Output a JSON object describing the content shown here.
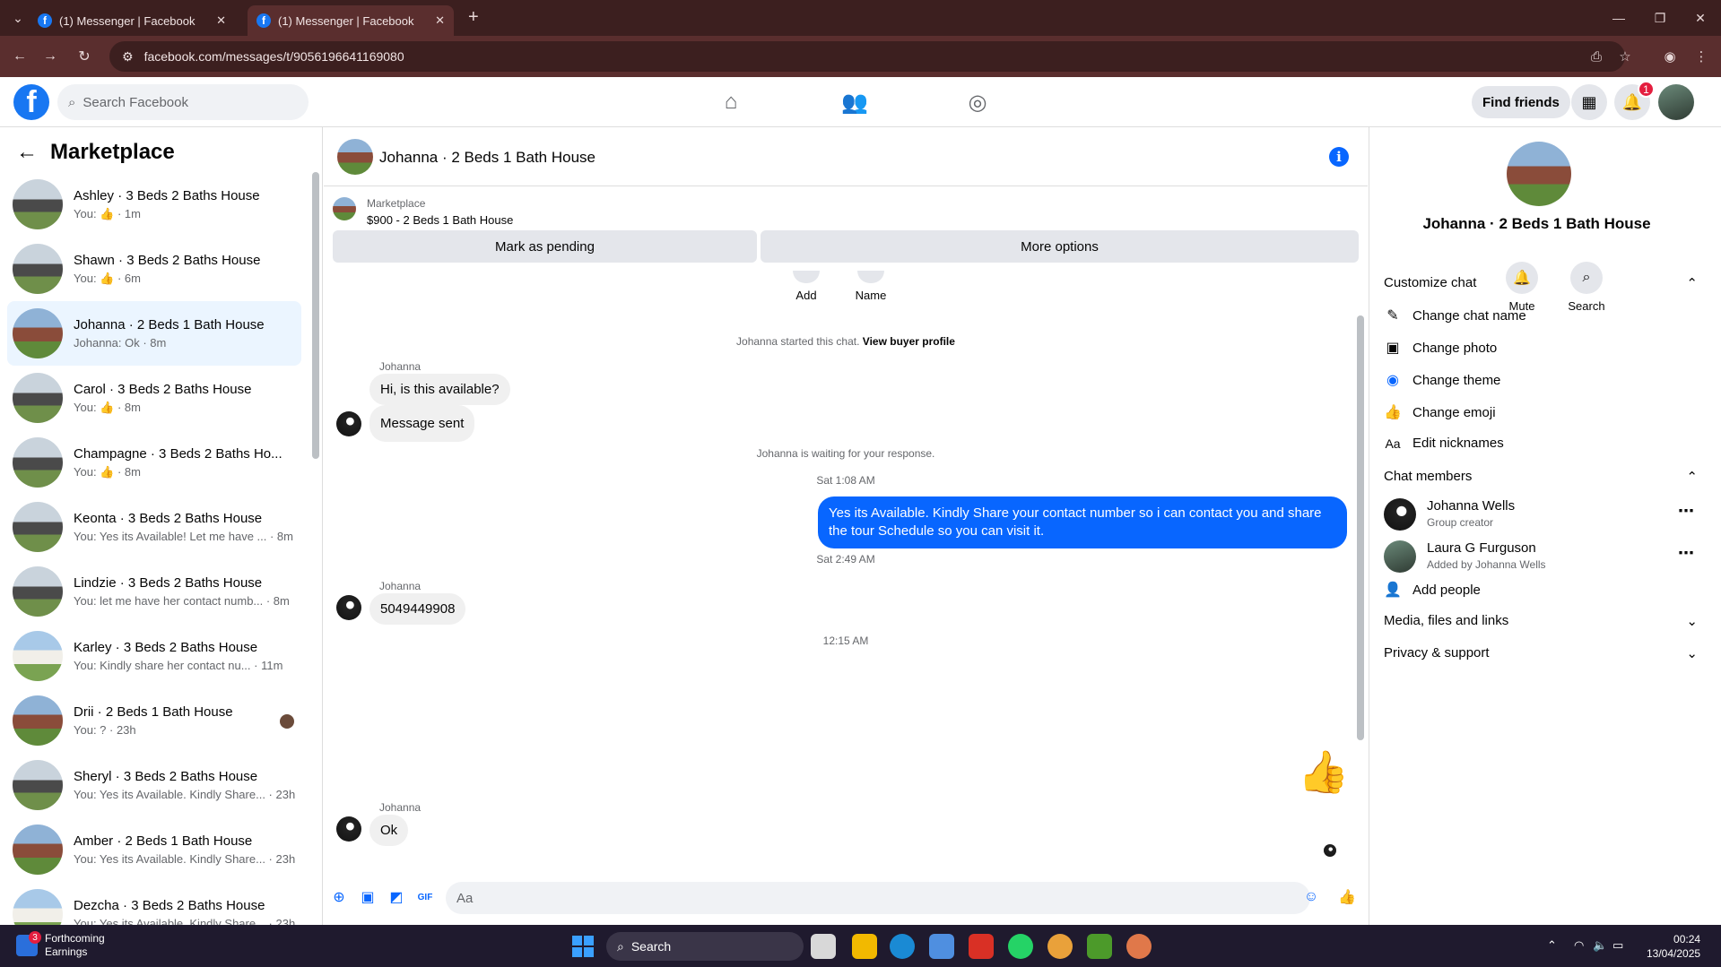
{
  "browser": {
    "tabs": [
      {
        "title": "(1) Messenger | Facebook",
        "active": false
      },
      {
        "title": "(1) Messenger | Facebook",
        "active": true
      }
    ],
    "url": "facebook.com/messages/t/9056196641169080"
  },
  "header": {
    "search_placeholder": "Search Facebook",
    "find_friends": "Find friends",
    "notification_count": "1"
  },
  "sidebar": {
    "title": "Marketplace",
    "conversations": [
      {
        "name": "Ashley · 3 Beds 2 Baths House",
        "preview": "You: 👍 · 1m",
        "photo": "gray"
      },
      {
        "name": "Shawn · 3 Beds 2 Baths House",
        "preview": "You: 👍 · 6m",
        "photo": "gray"
      },
      {
        "name": "Johanna · 2 Beds 1 Bath House",
        "preview": "Johanna: Ok · 8m",
        "photo": "brick",
        "selected": true
      },
      {
        "name": "Carol · 3 Beds 2 Baths House",
        "preview": "You: 👍 · 8m",
        "photo": "gray"
      },
      {
        "name": "Champagne · 3 Beds 2 Baths Ho...",
        "preview": "You: 👍 · 8m",
        "photo": "gray"
      },
      {
        "name": "Keonta · 3 Beds 2 Baths House",
        "preview": "You: Yes its Available! Let me have ... · 8m",
        "photo": "gray"
      },
      {
        "name": "Lindzie · 3 Beds 2 Baths House",
        "preview": "You: let me have her contact numb... · 8m",
        "photo": "gray"
      },
      {
        "name": "Karley · 3 Beds 2 Baths House",
        "preview": "You: Kindly share her contact nu... · 11m",
        "photo": "white"
      },
      {
        "name": "Drii · 2 Beds 1 Bath House",
        "preview": "You: ? · 23h",
        "photo": "brick",
        "dot": true
      },
      {
        "name": "Sheryl · 3 Beds 2 Baths House",
        "preview": "You: Yes its Available. Kindly Share... · 23h",
        "photo": "gray"
      },
      {
        "name": "Amber · 2 Beds 1 Bath House",
        "preview": "You: Yes its Available. Kindly Share... · 23h",
        "photo": "brick"
      },
      {
        "name": "Dezcha · 3 Beds 2 Baths House",
        "preview": "You: Yes its Available. Kindly Share... · 23h",
        "photo": "white"
      }
    ]
  },
  "chat": {
    "title": "Johanna · 2 Beds 1 Bath House",
    "marketplace_label": "Marketplace",
    "listing": "$900 - 2 Beds 1 Bath House",
    "mark_pending": "Mark as pending",
    "more_options": "More options",
    "mini_actions": [
      "Add",
      "Name"
    ],
    "started_text": "Johanna started this chat.",
    "view_profile": "View buyer profile",
    "sender_name": "Johanna",
    "msg1": "Hi, is this available?",
    "msg2": "Message sent",
    "waiting": "Johanna is waiting for your response.",
    "time1": "Sat 1:08 AM",
    "out_msg": "Yes its Available. Kindly Share your contact number so i can contact you and share the tour Schedule so you can visit it.",
    "time2": "Sat 2:49 AM",
    "phone": "5049449908",
    "time3": "12:15 AM",
    "msg_ok": "Ok",
    "composer_placeholder": "Aa"
  },
  "details": {
    "name": "Johanna · 2 Beds 1 Bath House",
    "mute": "Mute",
    "search": "Search",
    "customize": "Customize chat",
    "change_name": "Change chat name",
    "change_photo": "Change photo",
    "change_theme": "Change theme",
    "change_emoji": "Change emoji",
    "edit_nicknames": "Edit nicknames",
    "nick_icon": "Aa",
    "members_title": "Chat members",
    "members": [
      {
        "name": "Johanna Wells",
        "sub": "Group creator"
      },
      {
        "name": "Laura G Furguson",
        "sub": "Added by Johanna Wells"
      }
    ],
    "add_people": "Add people",
    "media": "Media, files and links",
    "privacy": "Privacy & support"
  },
  "taskbar": {
    "widget_title": "Forthcoming",
    "widget_sub": "Earnings",
    "widget_badge": "3",
    "search": "Search",
    "time": "00:24",
    "date": "13/04/2025"
  },
  "colors": {
    "accent": "#0866ff",
    "chrome": "#3c1f1f",
    "selected": "#ebf5ff"
  }
}
